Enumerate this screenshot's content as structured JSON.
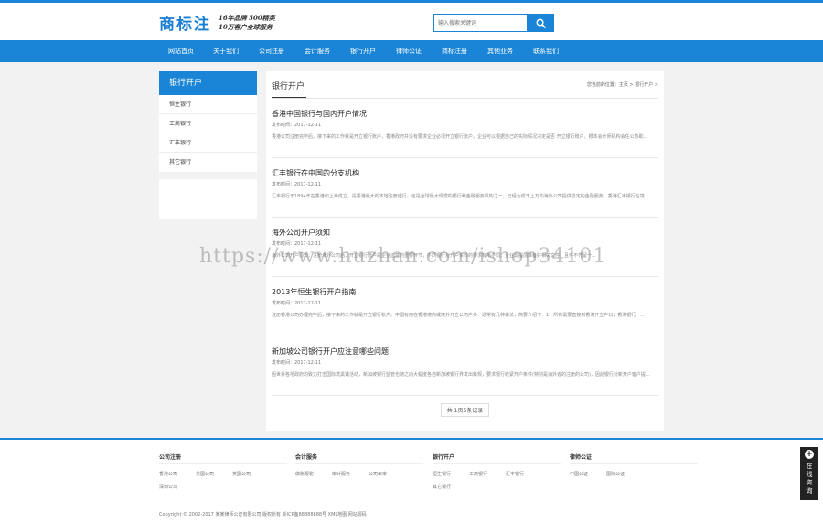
{
  "header": {
    "logo": "商标注",
    "slogan_line1": "16年品牌 500精英",
    "slogan_line2": "10万客户全球服务",
    "search_placeholder": "输入搜索关键词"
  },
  "nav": {
    "items": [
      "网站首页",
      "关于我们",
      "公司注册",
      "会计服务",
      "银行开户",
      "律师公证",
      "商标注册",
      "其他业务",
      "联系我们"
    ]
  },
  "sidebar": {
    "title": "银行开户",
    "items": [
      "恒生银行",
      "工商银行",
      "汇丰银行",
      "其它银行"
    ]
  },
  "main": {
    "title": "银行开户",
    "breadcrumb": "您当前的位置：主页 > 银行开户 >",
    "articles": [
      {
        "title": "香港中国银行与国内开户情况",
        "date": "发布时间：2017-12-11",
        "summary": "香港公司注册完毕后，接下来的工作就是开立银行账户，香港政府并没有要求企业必须开立银行账户，企业可以根据自己的实际情况决定是否 开立银行账户。根本会计师机构会任公协助..."
      },
      {
        "title": "汇丰银行在中国的分支机构",
        "date": "发布时间：2017-12-11",
        "summary": "汇丰银行于1894年在香港和上海成立，是香港最大的本地注册银行，也是全球最大规模的银行和金融服务机构之一，已经为成千上万的海外公司提供稳定的金融服务。香港汇丰银行在境..."
      },
      {
        "title": "海外公司开户须知",
        "date": "发布时间：2017-12-11",
        "summary": "海外公司开户须知：注册海外公司后，开立银行账户是企业运营的重要环节，不同银行对开户资料的要求有所不同，企业需提前准备好相关文件，且件不齐留一..."
      },
      {
        "title": "2013年恒生银行开户指南",
        "date": "发布时间：2017-12-11",
        "summary": "注册香港公司办理完毕后，接下来的工作就是开立银行帐户。中国有两在香港境内或境外开立公司户头：通常有几种做法，简要介绍下：1．所有需要直接到香港开立户口；香港银行一..."
      },
      {
        "title": "新加坡公司银行开户应注意哪些问题",
        "date": "发布时间：2017-12-11",
        "summary": "因世界各地政府均致力打击国际洗黑钱活动，新加坡银行监管也随之向大幅度各自新加坡银行界发出新规，要求银行收紧开户条件(特别是海外省的注册的公司)，因此银行对新开户客户提..."
      }
    ],
    "pager": "共 1页5条记录"
  },
  "watermark": "https://www.huzhan.com/ishop34101",
  "footer": {
    "columns": [
      {
        "title": "公司注册",
        "links": [
          "香港公司",
          "美国公司",
          "英国公司",
          "深圳公司"
        ]
      },
      {
        "title": "会计服务",
        "links": [
          "做账报税",
          "审计服务",
          "公司年审"
        ]
      },
      {
        "title": "银行开户",
        "links": [
          "恒生银行",
          "工商银行",
          "汇丰银行",
          "其它银行"
        ]
      },
      {
        "title": "律师公证",
        "links": [
          "中国公证",
          "国际公证"
        ]
      }
    ],
    "copyright": "Copyright © 2002-2017 某某律师公证有限公司 版权所有  浙ICP备88888888号  XML地图  网站源码"
  },
  "consult": {
    "icon": "+",
    "label": "在线咨询"
  },
  "colors": {
    "accent": "#1a85d6"
  }
}
